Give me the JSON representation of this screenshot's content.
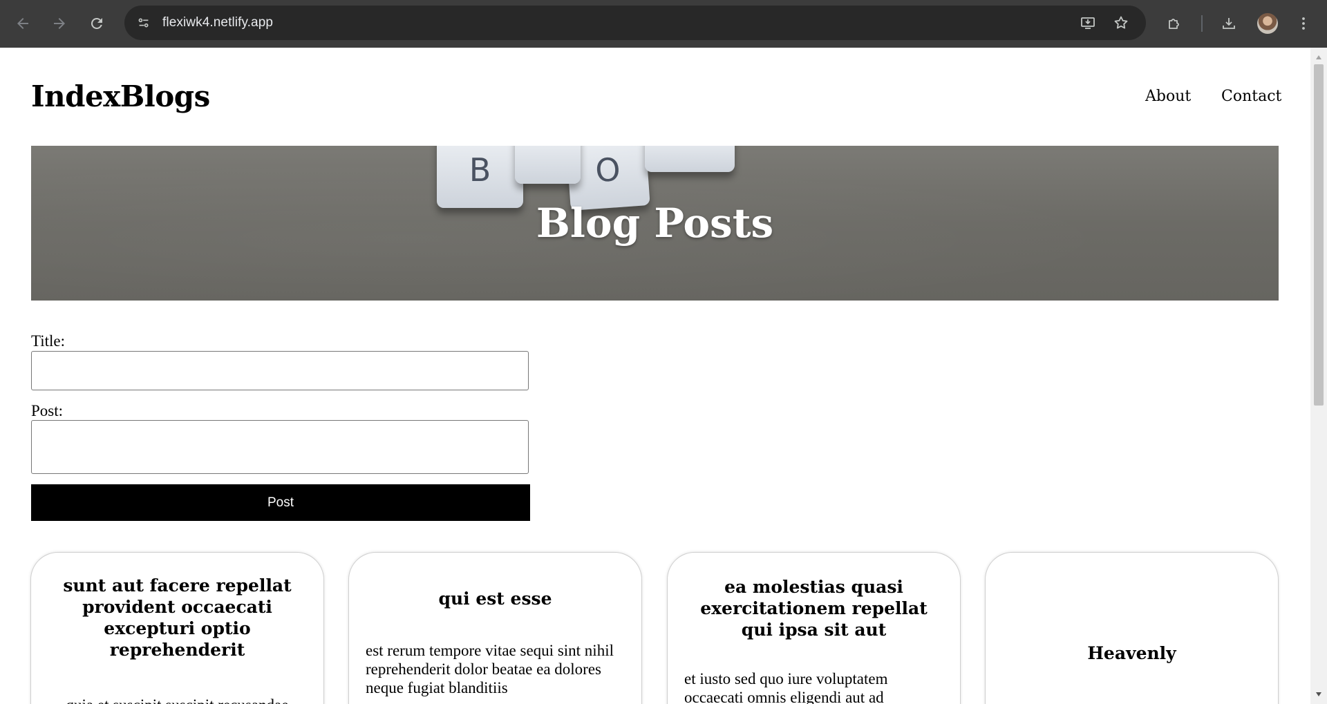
{
  "browser": {
    "url": "flexiwk4.netlify.app"
  },
  "site": {
    "title": "IndexBlogs",
    "nav": [
      {
        "label": "About"
      },
      {
        "label": "Contact"
      }
    ]
  },
  "hero": {
    "title": "Blog Posts",
    "keys": [
      "B",
      "O"
    ]
  },
  "form": {
    "title_label": "Title:",
    "title_value": "",
    "post_label": "Post:",
    "post_value": "",
    "submit_label": "Post"
  },
  "posts": [
    {
      "title": "sunt aut facere repellat provident occaecati excepturi optio reprehenderit",
      "body": "quia et suscipit suscipit recusandae"
    },
    {
      "title": "qui est esse",
      "body": "est rerum tempore vitae sequi sint nihil reprehenderit dolor beatae ea dolores neque fugiat blanditiis"
    },
    {
      "title": "ea molestias quasi exercitationem repellat qui ipsa sit aut",
      "body": "et iusto sed quo iure voluptatem occaecati omnis eligendi aut ad"
    },
    {
      "title": "Heavenly",
      "body": ""
    }
  ]
}
